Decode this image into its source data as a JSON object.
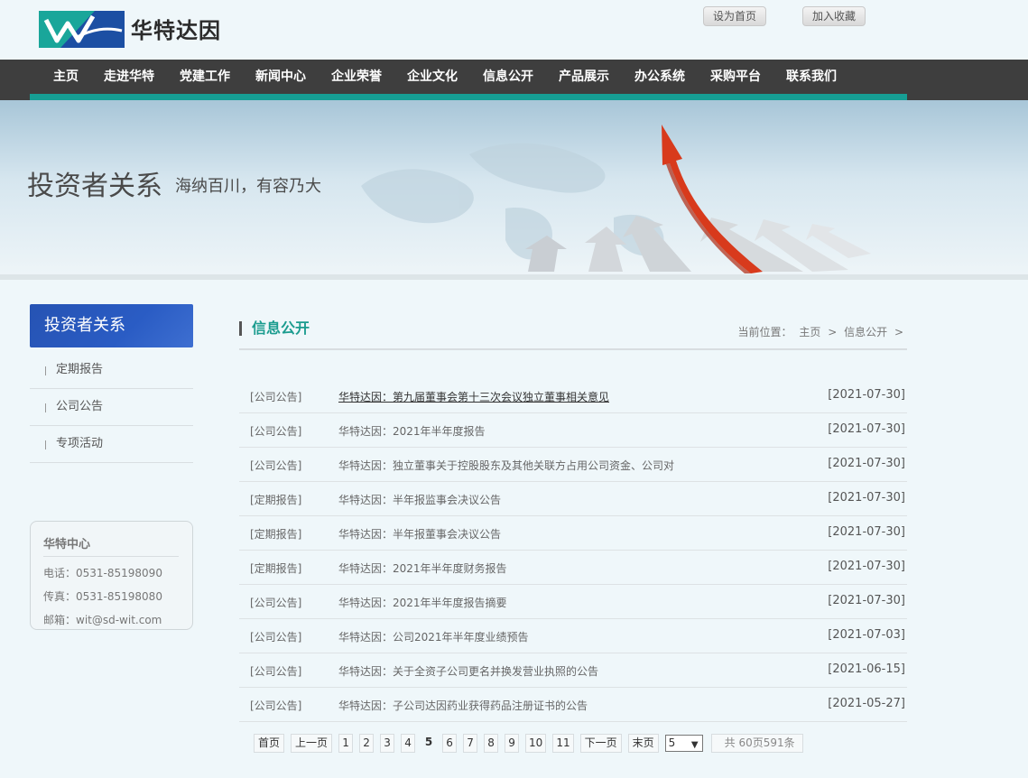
{
  "header": {
    "brand": "华特达因",
    "set_home": "设为首页",
    "add_fav": "加入收藏"
  },
  "nav": [
    "主页",
    "走进华特",
    "党建工作",
    "新闻中心",
    "企业荣誉",
    "企业文化",
    "信息公开",
    "产品展示",
    "办公系统",
    "采购平台",
    "联系我们"
  ],
  "banner": {
    "title": "投资者关系",
    "subtitle": "海纳百川，有容乃大"
  },
  "sidebar": {
    "heading": "投资者关系",
    "items": [
      "定期报告",
      "公司公告",
      "专项活动"
    ],
    "contact": {
      "title": "华特中心",
      "phone": "电话：0531-85198090",
      "fax": "传真：0531-85198080",
      "email": "邮箱：wit@sd-wit.com"
    }
  },
  "main": {
    "section_title": "信息公开",
    "breadcrumb": {
      "prefix": "当前位置：",
      "items": [
        "主页",
        "信息公开"
      ],
      "sep": ">"
    },
    "rows": [
      {
        "cat": "[公司公告]",
        "title": "华特达因：第九届董事会第十三次会议独立董事相关意见",
        "date": "[2021-07-30]"
      },
      {
        "cat": "[公司公告]",
        "title": "华特达因：2021年半年度报告",
        "date": "[2021-07-30]"
      },
      {
        "cat": "[公司公告]",
        "title": "华特达因：独立董事关于控股股东及其他关联方占用公司资金、公司对",
        "date": "[2021-07-30]"
      },
      {
        "cat": "[定期报告]",
        "title": "华特达因：半年报监事会决议公告",
        "date": "[2021-07-30]"
      },
      {
        "cat": "[定期报告]",
        "title": "华特达因：半年报董事会决议公告",
        "date": "[2021-07-30]"
      },
      {
        "cat": "[定期报告]",
        "title": "华特达因：2021年半年度财务报告",
        "date": "[2021-07-30]"
      },
      {
        "cat": "[公司公告]",
        "title": "华特达因：2021年半年度报告摘要",
        "date": "[2021-07-30]"
      },
      {
        "cat": "[公司公告]",
        "title": "华特达因：公司2021年半年度业绩预告",
        "date": "[2021-07-03]"
      },
      {
        "cat": "[公司公告]",
        "title": "华特达因：关于全资子公司更名并换发营业执照的公告",
        "date": "[2021-06-15]"
      },
      {
        "cat": "[公司公告]",
        "title": "华特达因：子公司达因药业获得药品注册证书的公告",
        "date": "[2021-05-27]"
      }
    ],
    "pager": {
      "first": "首页",
      "prev": "上一页",
      "pages": [
        "1",
        "2",
        "3",
        "4",
        "5",
        "6",
        "7",
        "8",
        "9",
        "10",
        "11"
      ],
      "current": "5",
      "next": "下一页",
      "last": "末页",
      "select_value": "5",
      "total": "共 60页591条"
    }
  },
  "colors": {
    "nav_bg": "#3e3e3e",
    "accent_teal": "#169e94",
    "sidebar_blue": "#2a5cc4",
    "section_title": "#1b9c8f"
  }
}
